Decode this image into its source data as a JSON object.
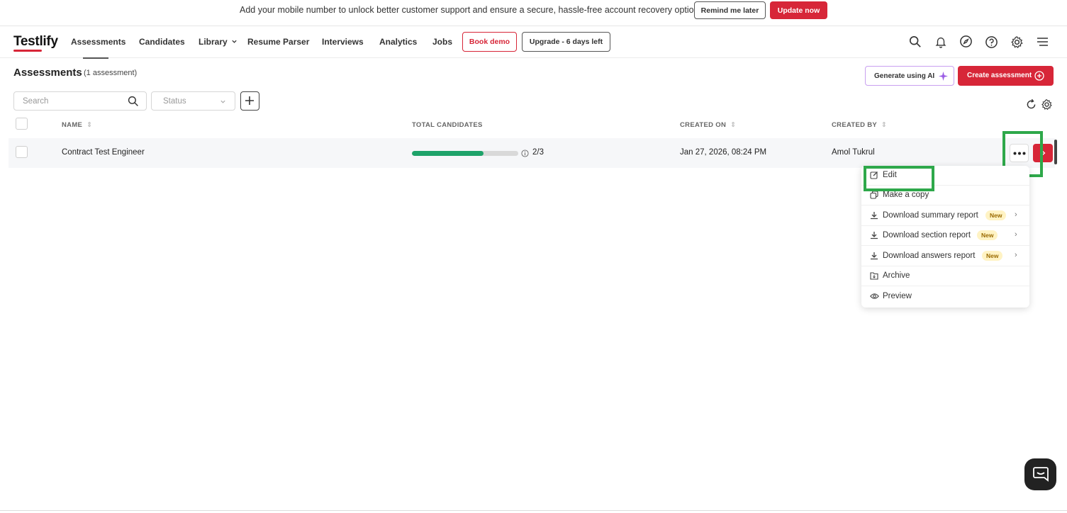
{
  "banner": {
    "message": "Add your mobile number to unlock better customer support and ensure a secure, hassle-free account recovery option!",
    "remind_label": "Remind me later",
    "update_label": "Update now"
  },
  "nav": {
    "logo": "Testlify",
    "items": [
      {
        "label": "Assessments"
      },
      {
        "label": "Candidates"
      },
      {
        "label": "Library"
      },
      {
        "label": "Resume Parser"
      },
      {
        "label": "Interviews"
      },
      {
        "label": "Analytics"
      },
      {
        "label": "Jobs"
      }
    ],
    "book_demo": "Book demo",
    "upgrade": "Upgrade - 6 days left",
    "icons": [
      "search-icon",
      "bell-icon",
      "compass-icon",
      "help-icon",
      "gear-icon",
      "menu-icon"
    ]
  },
  "page": {
    "title": "Assessments",
    "subtitle": "(1 assessment)",
    "generate_ai": "Generate using AI",
    "create": "Create assessment"
  },
  "filters": {
    "search_placeholder": "Search",
    "status_placeholder": "Status"
  },
  "table": {
    "headers": {
      "name": "NAME",
      "total_candidates": "TOTAL CANDIDATES",
      "created_on": "CREATED ON",
      "created_by": "CREATED BY"
    },
    "rows": [
      {
        "name": "Contract Test Engineer",
        "candidates_text": "2/3",
        "progress": 0.67,
        "created_on": "Jan 27, 2026, 08:24 PM",
        "created_by": "Amol Tukrul"
      }
    ]
  },
  "menu": {
    "items": [
      {
        "label": "Edit"
      },
      {
        "label": "Make a copy"
      },
      {
        "label": "Download summary report",
        "badge": "New"
      },
      {
        "label": "Download section report",
        "badge": "New"
      },
      {
        "label": "Download answers report",
        "badge": "New"
      },
      {
        "label": "Archive"
      },
      {
        "label": "Preview"
      }
    ]
  },
  "colors": {
    "brand_red": "#d72638",
    "progress_green": "#1ea36a",
    "highlight_green": "#2ea84a"
  }
}
